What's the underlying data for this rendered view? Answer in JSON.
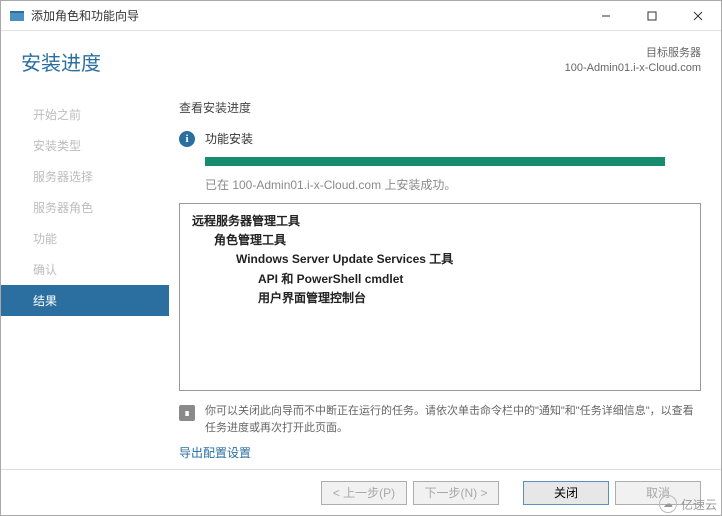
{
  "window": {
    "title": "添加角色和功能向导"
  },
  "header": {
    "title": "安装进度",
    "target_label": "目标服务器",
    "target_server": "100-Admin01.i-x-Cloud.com"
  },
  "sidebar": {
    "steps": [
      {
        "label": "开始之前"
      },
      {
        "label": "安装类型"
      },
      {
        "label": "服务器选择"
      },
      {
        "label": "服务器角色"
      },
      {
        "label": "功能"
      },
      {
        "label": "确认"
      },
      {
        "label": "结果"
      }
    ],
    "active_index": 6
  },
  "main": {
    "section_label": "查看安装进度",
    "status_label": "功能安装",
    "success_text": "已在 100-Admin01.i-x-Cloud.com 上安装成功。",
    "results": {
      "l1": "远程服务器管理工具",
      "l2": "角色管理工具",
      "l3": "Windows Server Update Services 工具",
      "l4a": "API 和 PowerShell cmdlet",
      "l4b": "用户界面管理控制台"
    },
    "note_text": "你可以关闭此向导而不中断正在运行的任务。请依次单击命令栏中的\"通知\"和\"任务详细信息\"，以查看任务进度或再次打开此页面。",
    "export_link": "导出配置设置"
  },
  "footer": {
    "prev": "< 上一步(P)",
    "next": "下一步(N) >",
    "close": "关闭",
    "cancel": "取消"
  },
  "watermark": {
    "text": "亿速云"
  }
}
